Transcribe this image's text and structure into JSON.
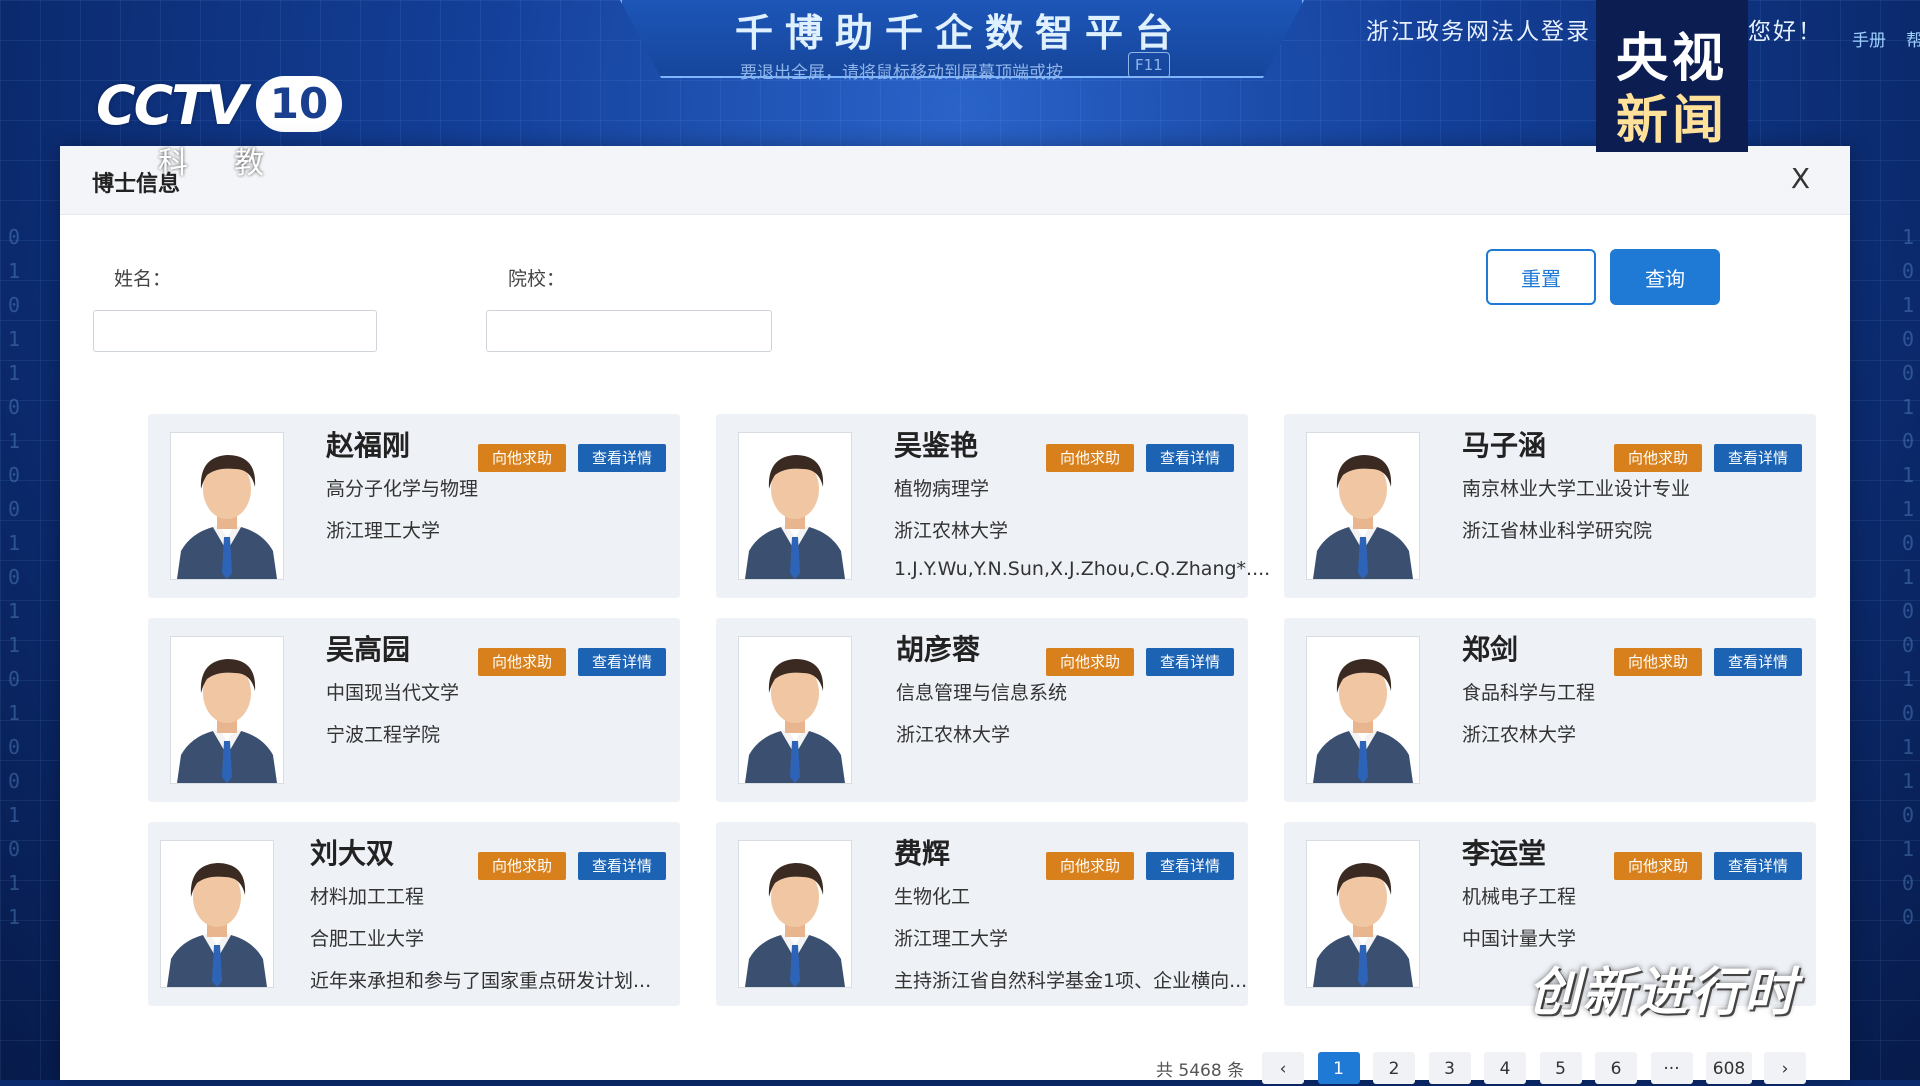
{
  "header": {
    "platform_title": "千博助千企数智平台",
    "fullscreen_hint": "要退出全屏，请将鼠标移动到屏幕顶端或按",
    "fullscreen_key": "F11",
    "login_text": "浙江政务网法人登录",
    "greeting": "您好！",
    "manual": "手册",
    "manual_extra": "帮"
  },
  "broadcast": {
    "channel_word": "CCTV",
    "channel_number": "10",
    "channel_sub": "科教",
    "news_line1": "央视",
    "news_line2": "新闻",
    "program_watermark": "创新进行时"
  },
  "modal": {
    "title": "博士信息",
    "close_label": "X",
    "name_label": "姓名：",
    "school_label": "院校：",
    "name_value": "",
    "school_value": "",
    "reset_label": "重置",
    "query_label": "查询"
  },
  "card_buttons": {
    "help": "向他求助",
    "detail": "查看详情"
  },
  "doctors": [
    {
      "name": "赵福刚",
      "major": "高分子化学与物理",
      "institution": "浙江理工大学",
      "summary": ""
    },
    {
      "name": "吴鉴艳",
      "major": "植物病理学",
      "institution": "浙江农林大学",
      "summary": "1.J.Y.Wu,Y.N.Sun,X.J.Zhou,C.Q.Zhang*...."
    },
    {
      "name": "马子涵",
      "major": "南京林业大学工业设计专业",
      "institution": "浙江省林业科学研究院",
      "summary": ""
    },
    {
      "name": "吴高园",
      "major": "中国现当代文学",
      "institution": "宁波工程学院",
      "summary": ""
    },
    {
      "name": "胡彦蓉",
      "major": "信息管理与信息系统",
      "institution": "浙江农林大学",
      "summary": ""
    },
    {
      "name": "郑剑",
      "major": "食品科学与工程",
      "institution": "浙江农林大学",
      "summary": ""
    },
    {
      "name": "刘大双",
      "major": "材料加工工程",
      "institution": "合肥工业大学",
      "summary": "近年来承担和参与了国家重点研发计划..."
    },
    {
      "name": "费辉",
      "major": "生物化工",
      "institution": "浙江理工大学",
      "summary": "主持浙江省自然科学基金1项、企业横向..."
    },
    {
      "name": "李运堂",
      "major": "机械电子工程",
      "institution": "中国计量大学",
      "summary": ""
    }
  ],
  "pagination": {
    "total": "共 5468 条",
    "prev": "‹",
    "pages": [
      "1",
      "2",
      "3",
      "4",
      "5",
      "6",
      "···",
      "608"
    ],
    "next": "›",
    "active_page": "1"
  },
  "colors": {
    "help_button": "#d8801b",
    "detail_button": "#1c63b4",
    "primary": "#1f7ad6"
  }
}
